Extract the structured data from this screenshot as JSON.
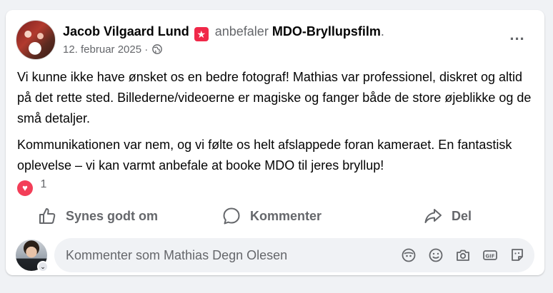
{
  "post": {
    "author": "Jacob Vilgaard Lund",
    "recommends_text": "anbefaler",
    "page_name": "MDO-Bryllupsfilm",
    "period": ".",
    "date": "12. februar 2025",
    "separator": "·",
    "more_label": "...",
    "paragraphs": [
      "Vi kunne ikke have ønsket os en bedre fotograf! Mathias var professionel, diskret og altid på det rette sted. Billederne/videoerne er magiske og fanger både de store øjeblikke og de små detaljer.",
      "Kommunikationen var nem, og vi følte os helt afslappede foran kameraet. En fantastisk oplevelse – vi kan varmt anbefale at booke MDO til jeres bryllup!"
    ],
    "reaction_count": "1"
  },
  "actions": {
    "like": "Synes godt om",
    "comment": "Kommenter",
    "share": "Del"
  },
  "composer": {
    "placeholder": "Kommenter som Mathias Degn Olesen"
  },
  "colors": {
    "recommend_badge": "#f02849",
    "heart": "#f33e58",
    "secondary_text": "#65676b"
  }
}
